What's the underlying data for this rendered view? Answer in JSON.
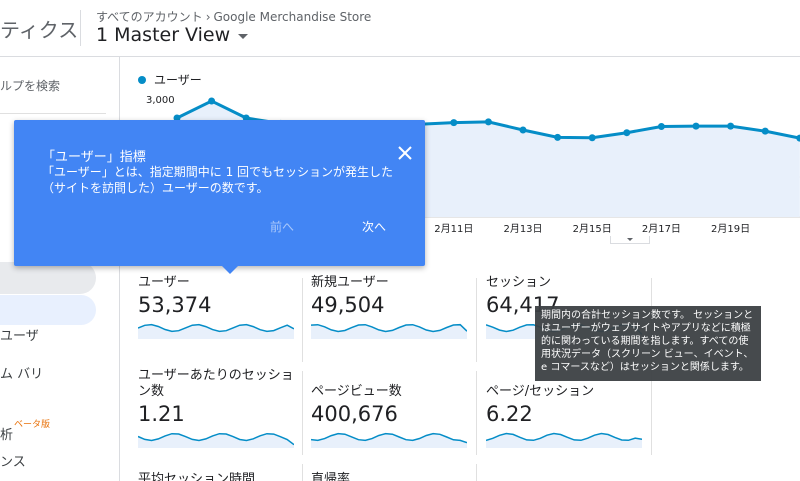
{
  "header": {
    "app_title": "ティクス",
    "breadcrumb": {
      "account": "すべてのアカウント",
      "separator": "›",
      "property": "Google Merchandise Store"
    },
    "view_name": "1 Master View"
  },
  "sidebar": {
    "search_placeholder": "ルプを検索",
    "items": [
      {
        "label": "ユーザ"
      },
      {
        "label": "ム バリ"
      },
      {
        "label": "析"
      },
      {
        "label": "ンス"
      }
    ],
    "beta_badge": "ベータ版"
  },
  "chart_data": {
    "type": "line",
    "legend": "ユーザー",
    "y_tick": "3,000",
    "ylim": [
      0,
      3600
    ],
    "x_ticks": [
      "2月11日",
      "2月13日",
      "2月15日",
      "2月17日",
      "2月19日"
    ],
    "series": [
      {
        "name": "ユーザー",
        "color": "#058dc7",
        "values": [
          2560,
          3000,
          2560,
          2420,
          2300,
          2300,
          2300,
          2400,
          2440,
          2460,
          2250,
          2060,
          2050,
          2180,
          2340,
          2350,
          2350,
          2220,
          2040
        ]
      }
    ]
  },
  "metrics": [
    {
      "label": "ユーザー",
      "value": "53,374"
    },
    {
      "label": "新規ユーザー",
      "value": "49,504"
    },
    {
      "label": "セッション",
      "value": "64,417"
    },
    {
      "label": "ユーザーあたりのセッション数",
      "value": "1.21"
    },
    {
      "label": "ページビュー数",
      "value": "400,676"
    },
    {
      "label": "ページ/セッション",
      "value": "6.22"
    },
    {
      "label": "平均セッション時間",
      "value": ""
    },
    {
      "label": "直帰率",
      "value": ""
    }
  ],
  "info_card": {
    "title": "「ユーザー」指標",
    "body": "「ユーザー」とは、指定期間中に 1 回でもセッションが発生した（サイトを訪問した）ユーザーの数です。",
    "prev_label": "前へ",
    "next_label": "次へ"
  },
  "session_tooltip": {
    "text": "期間内の合計セッション数です。 セッションとはユーザーがウェブサイトやアプリなどに積極的に関わっている期間を指します。すべての使用状況データ（スクリーン ビュー、イベント、e コマースなど）はセッションと関係します。"
  },
  "colors": {
    "accent": "#4285f4",
    "line": "#058dc7",
    "area": "#e8f0fb",
    "beta": "#e8710a"
  }
}
